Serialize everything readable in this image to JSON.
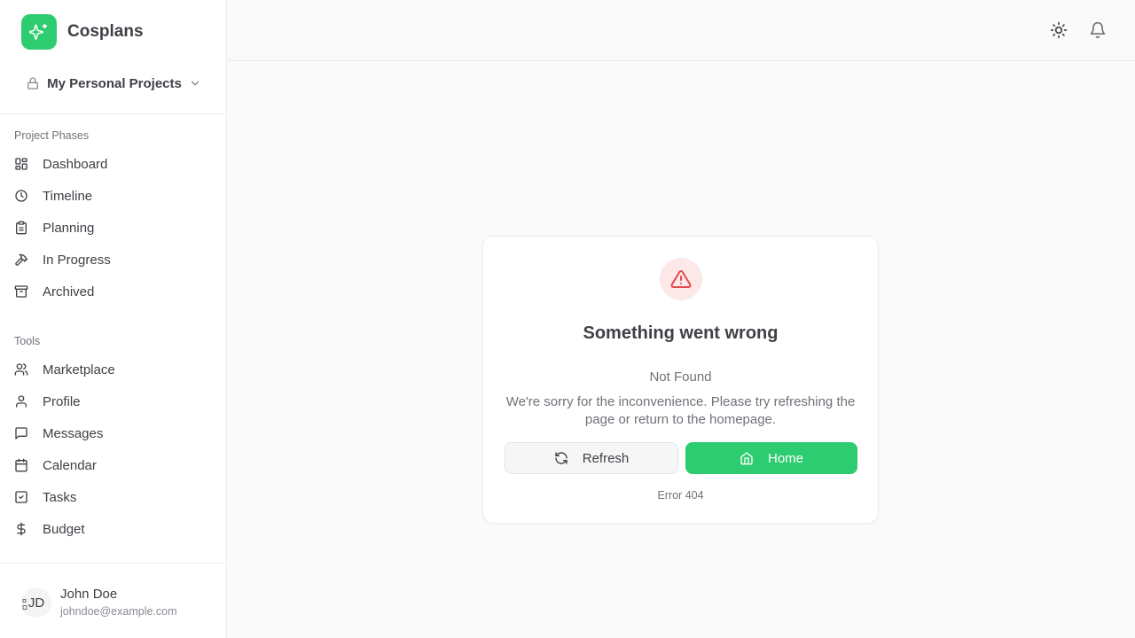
{
  "app": {
    "name": "Cosplans",
    "logo_icon": "sparkles-icon",
    "accent": "#2ecc71"
  },
  "project_selector": {
    "label": "My Personal Projects",
    "lead_icon": "lock-icon",
    "trail_icon": "chevron-down-icon"
  },
  "sidebar": {
    "phases_label": "Project Phases",
    "phases": [
      {
        "label": "Dashboard",
        "icon": "dashboard-icon"
      },
      {
        "label": "Timeline",
        "icon": "clock-icon"
      },
      {
        "label": "Planning",
        "icon": "clipboard-icon"
      },
      {
        "label": "In Progress",
        "icon": "hammer-icon"
      },
      {
        "label": "Archived",
        "icon": "archive-icon"
      }
    ],
    "tools_label": "Tools",
    "tools": [
      {
        "label": "Marketplace",
        "icon": "users-icon"
      },
      {
        "label": "Profile",
        "icon": "user-icon"
      },
      {
        "label": "Messages",
        "icon": "message-icon"
      },
      {
        "label": "Calendar",
        "icon": "calendar-icon"
      },
      {
        "label": "Tasks",
        "icon": "check-square-icon"
      },
      {
        "label": "Budget",
        "icon": "dollar-icon"
      }
    ]
  },
  "user": {
    "initials": "JD",
    "name": "John Doe",
    "email": "johndoe@example.com"
  },
  "topbar": {
    "theme_icon": "sun-icon",
    "notifications_icon": "bell-icon"
  },
  "error": {
    "icon": "alert-triangle-icon",
    "title": "Something went wrong",
    "status": "Not Found",
    "message": "We're sorry for the inconvenience. Please try refreshing the page or return to the homepage.",
    "refresh_label": "Refresh",
    "home_label": "Home",
    "code": "Error 404",
    "danger_color": "#e5484d",
    "danger_bg": "#fde8e8"
  }
}
